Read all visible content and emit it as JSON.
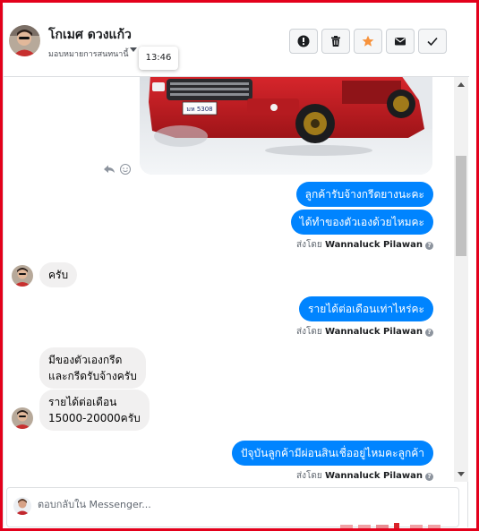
{
  "header": {
    "contact_name": "โกเมศ ดวงแก้ว",
    "assign_label": "มอบหมายการสนทนานี้",
    "tooltip_time": "13:46",
    "buttons": [
      "alert-icon",
      "trash-icon",
      "star-icon",
      "mail-icon",
      "check-icon"
    ]
  },
  "messages": [
    {
      "dir": "out",
      "text": "ลูกค้ารับจ้างกรีดยางนะคะ"
    },
    {
      "dir": "out",
      "text": "ได้ทำของตัวเองด้วยไหมคะ"
    },
    {
      "dir": "in",
      "text": "ครับ"
    },
    {
      "dir": "out",
      "text": "รายได้ต่อเดือนเท่าไหร่คะ"
    },
    {
      "dir": "in",
      "text_lines": [
        "มีของตัวเองกรีด",
        "และกรีดรับจ้างครับ"
      ]
    },
    {
      "dir": "in",
      "text_lines": [
        "รายได้ต่อเดือน",
        "15000-20000ครับ"
      ]
    },
    {
      "dir": "out",
      "text": "ปัจุบันลูกค้ามีผ่อนสินเชื่ออยู่ไหมคะลูกค้า"
    }
  ],
  "sent_by": {
    "prefix": "ส่งโดย",
    "name": "Wannaluck Pilawan",
    "info_icon": "?"
  },
  "car_plate": "มห 5308",
  "composer": {
    "placeholder": "ตอบกลับใน Messenger..."
  },
  "colors": {
    "outgoing": "#0084ff",
    "incoming": "#f1f0f0",
    "frame": "#e3001b",
    "star": "#f7923b"
  }
}
